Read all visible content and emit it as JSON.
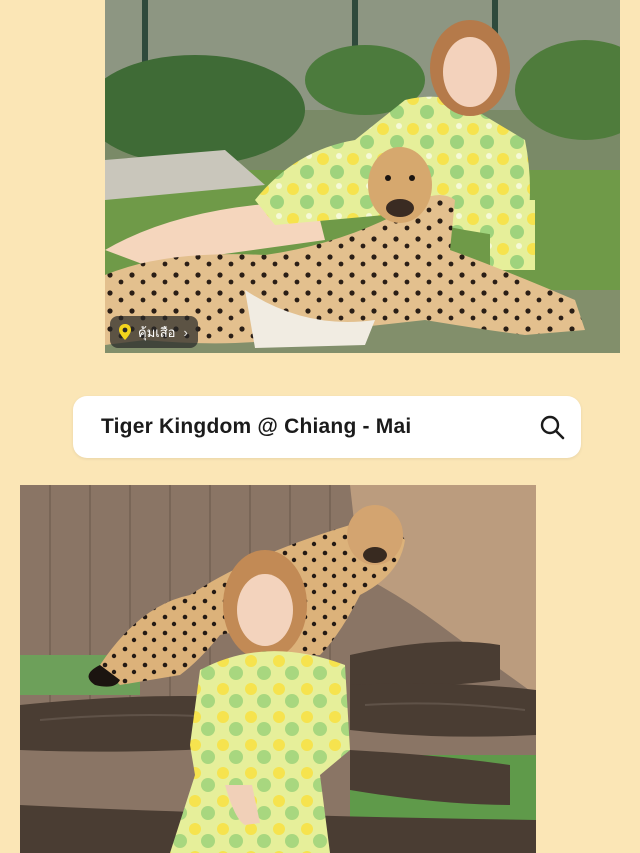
{
  "location_tag": {
    "label": "คุ้มเสือ",
    "chevron": "›",
    "icon": "location-pin-icon",
    "pin_color": "#f4d51c"
  },
  "search": {
    "query": "Tiger Kingdom @ Chiang - Mai",
    "icon": "search-icon"
  },
  "colors": {
    "background": "#fbe6b6",
    "search_bg": "#ffffff"
  }
}
